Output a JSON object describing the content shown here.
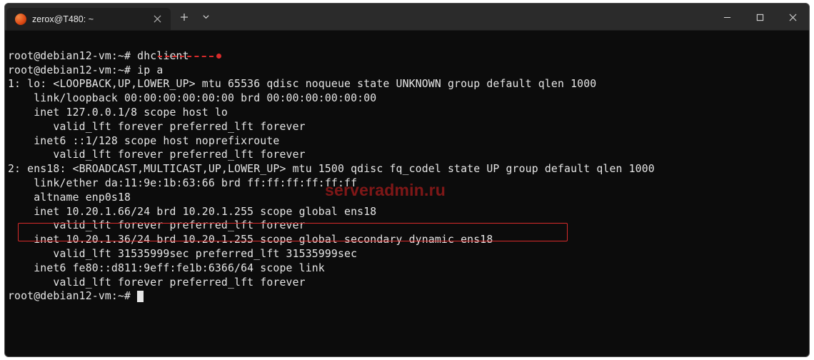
{
  "tab": {
    "title": "zerox@T480: ~"
  },
  "terminal": {
    "prompt": "root@debian12-vm:~#",
    "lines": [
      "root@debian12-vm:~# dhclient",
      "root@debian12-vm:~# ip a",
      "1: lo: <LOOPBACK,UP,LOWER_UP> mtu 65536 qdisc noqueue state UNKNOWN group default qlen 1000",
      "    link/loopback 00:00:00:00:00:00 brd 00:00:00:00:00:00",
      "    inet 127.0.0.1/8 scope host lo",
      "       valid_lft forever preferred_lft forever",
      "    inet6 ::1/128 scope host noprefixroute",
      "       valid_lft forever preferred_lft forever",
      "2: ens18: <BROADCAST,MULTICAST,UP,LOWER_UP> mtu 1500 qdisc fq_codel state UP group default qlen 1000",
      "    link/ether da:11:9e:1b:63:66 brd ff:ff:ff:ff:ff:ff",
      "    altname enp0s18",
      "    inet 10.20.1.66/24 brd 10.20.1.255 scope global ens18",
      "       valid_lft forever preferred_lft forever",
      "    inet 10.20.1.36/24 brd 10.20.1.255 scope global secondary dynamic ens18",
      "       valid_lft 31535999sec preferred_lft 31535999sec",
      "    inet6 fe80::d811:9eff:fe1b:6366/64 scope link",
      "       valid_lft forever preferred_lft forever"
    ]
  },
  "watermark": "serveradmin.ru"
}
